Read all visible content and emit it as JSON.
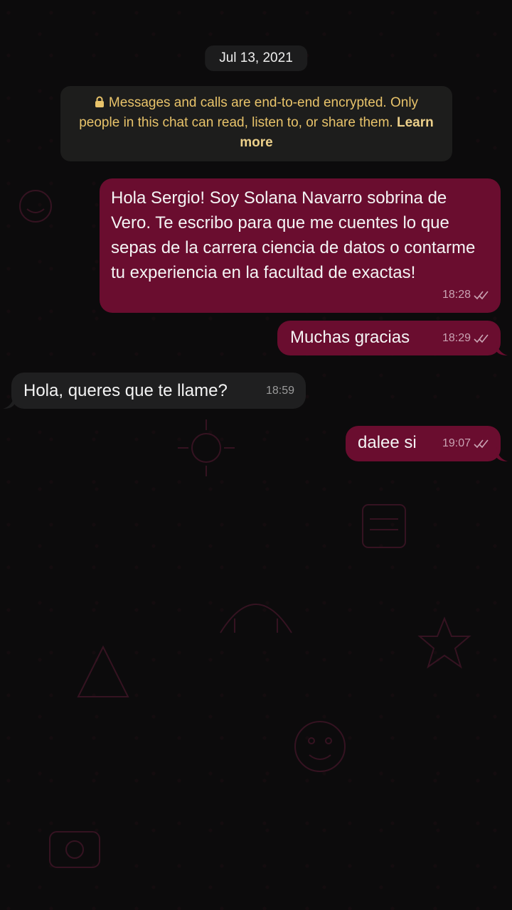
{
  "date_chip": "Jul 13, 2021",
  "encryption_notice": {
    "text": "Messages and calls are end-to-end encrypted. Only people in this chat can read, listen to, or share them.",
    "link": "Learn more"
  },
  "messages": [
    {
      "direction": "out",
      "text": "Hola Sergio! Soy Solana Navarro sobrina de Vero. Te escribo para que me cuentes lo que sepas de la carrera ciencia de datos o contarme tu experiencia en la facultad de exactas!",
      "time": "18:28",
      "status": "read"
    },
    {
      "direction": "out",
      "text": "Muchas gracias",
      "time": "18:29",
      "status": "read"
    },
    {
      "direction": "in",
      "text": "Hola, queres que te llame?",
      "time": "18:59"
    },
    {
      "direction": "out",
      "text": "dalee si",
      "time": "19:07",
      "status": "read"
    }
  ],
  "colors": {
    "outgoing_bubble": "#6a0d2f",
    "incoming_bubble": "#1f1f20",
    "notice_text": "#e8c36a",
    "read_ticks": "#c9a3b3"
  }
}
